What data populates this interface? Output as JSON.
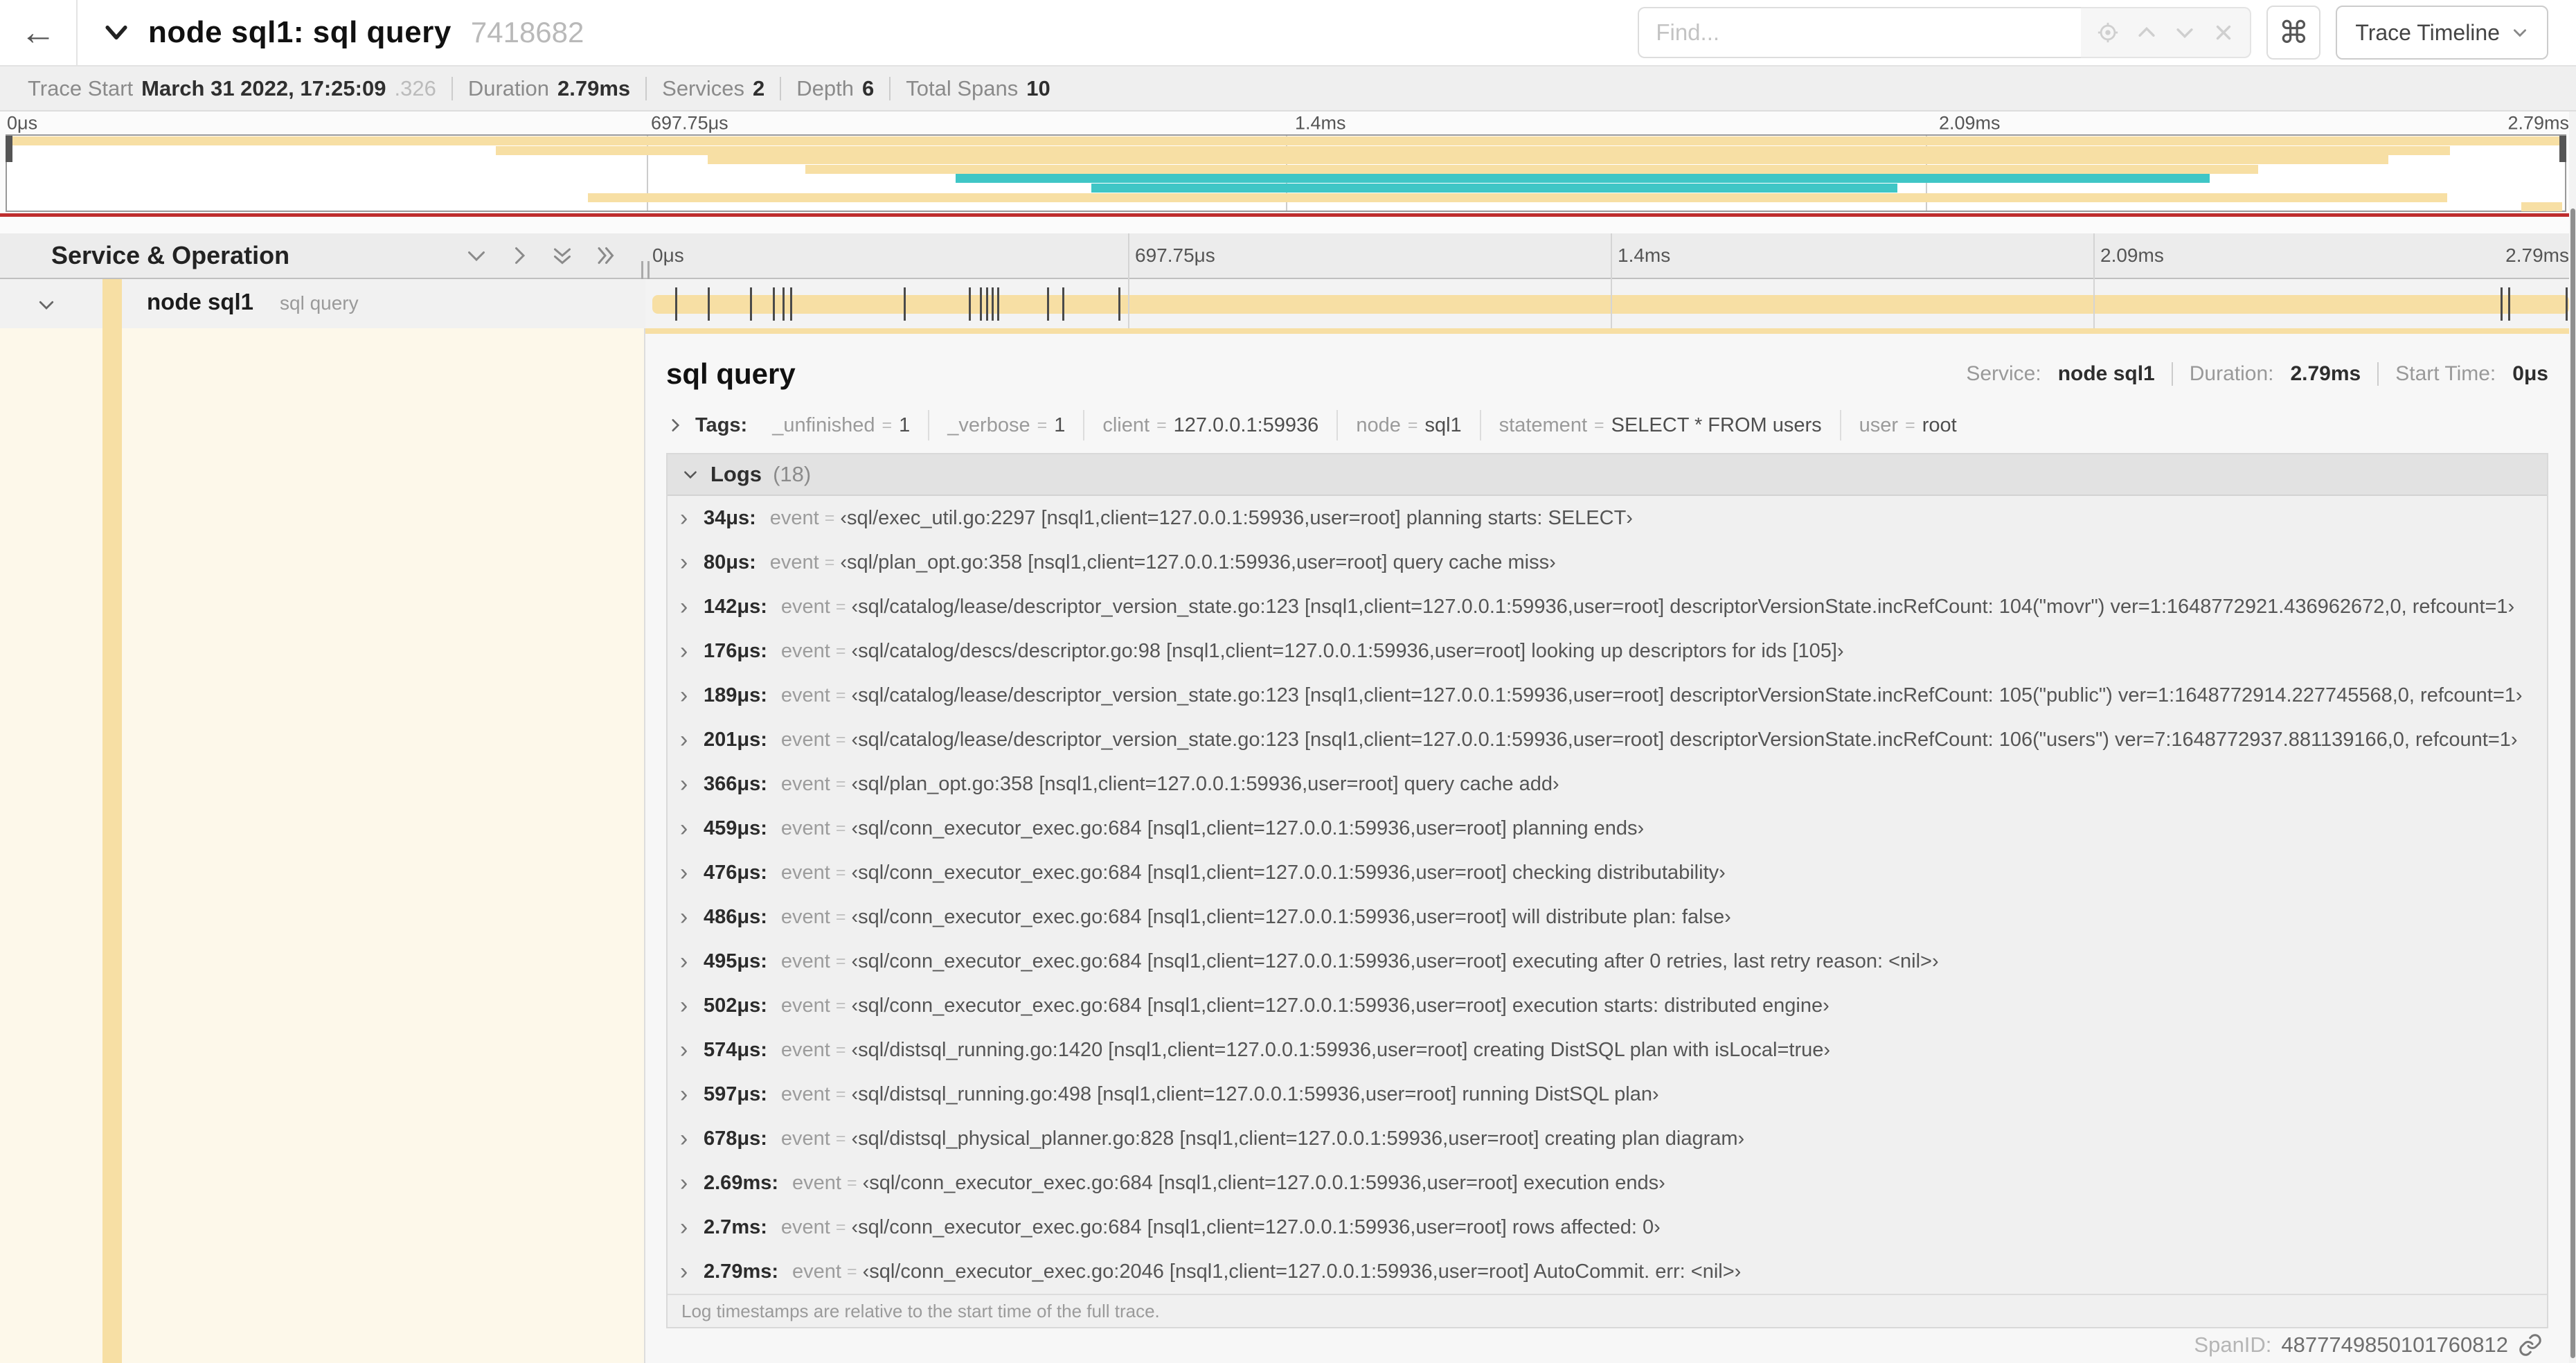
{
  "colors": {
    "tan": "#f7dfa4",
    "teal": "#3fc6c6",
    "red_line": "#be2d2d",
    "cream": "#fdf8ea"
  },
  "topbar": {
    "title": "node sql1: sql query",
    "trace_id": "7418682",
    "find_placeholder": "Find...",
    "command_icon": "⌘",
    "view_selector_label": "Trace Timeline"
  },
  "infobar": {
    "items": [
      {
        "label": "Trace Start",
        "value": "March 31 2022, 17:25:09",
        "suffix": ".326"
      },
      {
        "label": "Duration",
        "value": "2.79ms"
      },
      {
        "label": "Services",
        "value": "2"
      },
      {
        "label": "Depth",
        "value": "6"
      },
      {
        "label": "Total Spans",
        "value": "10"
      }
    ]
  },
  "timeline_ticks": [
    {
      "label": "0μs",
      "pct": 0
    },
    {
      "label": "697.75μs",
      "pct": 25
    },
    {
      "label": "1.4ms",
      "pct": 50
    },
    {
      "label": "2.09ms",
      "pct": 75
    },
    {
      "label": "2.79ms",
      "pct": 100
    }
  ],
  "minimap": {
    "spans": [
      {
        "row": 0,
        "start": 0,
        "end": 100,
        "color": "tan"
      },
      {
        "row": 1,
        "start": 19.1,
        "end": 95.5,
        "color": "tan"
      },
      {
        "row": 2,
        "start": 27.4,
        "end": 93.1,
        "color": "tan"
      },
      {
        "row": 3,
        "start": 31.2,
        "end": 88.0,
        "color": "tan"
      },
      {
        "row": 4,
        "start": 37.1,
        "end": 86.1,
        "color": "teal"
      },
      {
        "row": 5,
        "start": 42.4,
        "end": 73.9,
        "color": "teal"
      },
      {
        "row": 6,
        "start": 22.7,
        "end": 95.4,
        "color": "tan"
      },
      {
        "row": 7,
        "start": 98.3,
        "end": 99.9,
        "color": "tan"
      }
    ]
  },
  "table": {
    "header_label": "Service & Operation",
    "row": {
      "service": "node sql1",
      "operation": "sql query",
      "log_marks_pct": [
        1.2,
        2.9,
        5.1,
        6.3,
        6.8,
        7.2,
        13.1,
        16.5,
        17.1,
        17.4,
        17.7,
        18.0,
        20.6,
        21.4,
        24.3,
        96.4,
        96.8,
        99.8
      ]
    }
  },
  "detail": {
    "operation": "sql query",
    "service_label": "Service:",
    "service": "node sql1",
    "duration_label": "Duration:",
    "duration": "2.79ms",
    "start_label": "Start Time:",
    "start": "0μs",
    "tags": {
      "label": "Tags:",
      "items": [
        {
          "key": "_unfinished",
          "value": "1"
        },
        {
          "key": "_verbose",
          "value": "1"
        },
        {
          "key": "client",
          "value": "127.0.0.1:59936"
        },
        {
          "key": "node",
          "value": "sql1"
        },
        {
          "key": "statement",
          "value": "SELECT * FROM users"
        },
        {
          "key": "user",
          "value": "root"
        }
      ]
    },
    "logs": {
      "label": "Logs",
      "count": "(18)",
      "field_key": "event",
      "entries": [
        {
          "time": "34μs:",
          "value": "‹sql/exec_util.go:2297 [nsql1,client=127.0.0.1:59936,user=root] planning starts: SELECT›"
        },
        {
          "time": "80μs:",
          "value": "‹sql/plan_opt.go:358 [nsql1,client=127.0.0.1:59936,user=root] query cache miss›"
        },
        {
          "time": "142μs:",
          "value": "‹sql/catalog/lease/descriptor_version_state.go:123 [nsql1,client=127.0.0.1:59936,user=root] descriptorVersionState.incRefCount: 104(\"movr\") ver=1:1648772921.436962672,0, refcount=1›"
        },
        {
          "time": "176μs:",
          "value": "‹sql/catalog/descs/descriptor.go:98 [nsql1,client=127.0.0.1:59936,user=root] looking up descriptors for ids [105]›"
        },
        {
          "time": "189μs:",
          "value": "‹sql/catalog/lease/descriptor_version_state.go:123 [nsql1,client=127.0.0.1:59936,user=root] descriptorVersionState.incRefCount: 105(\"public\") ver=1:1648772914.227745568,0, refcount=1›"
        },
        {
          "time": "201μs:",
          "value": "‹sql/catalog/lease/descriptor_version_state.go:123 [nsql1,client=127.0.0.1:59936,user=root] descriptorVersionState.incRefCount: 106(\"users\") ver=7:1648772937.881139166,0, refcount=1›"
        },
        {
          "time": "366μs:",
          "value": "‹sql/plan_opt.go:358 [nsql1,client=127.0.0.1:59936,user=root] query cache add›"
        },
        {
          "time": "459μs:",
          "value": "‹sql/conn_executor_exec.go:684 [nsql1,client=127.0.0.1:59936,user=root] planning ends›"
        },
        {
          "time": "476μs:",
          "value": "‹sql/conn_executor_exec.go:684 [nsql1,client=127.0.0.1:59936,user=root] checking distributability›"
        },
        {
          "time": "486μs:",
          "value": "‹sql/conn_executor_exec.go:684 [nsql1,client=127.0.0.1:59936,user=root] will distribute plan: false›"
        },
        {
          "time": "495μs:",
          "value": "‹sql/conn_executor_exec.go:684 [nsql1,client=127.0.0.1:59936,user=root] executing after 0 retries, last retry reason: <nil>›"
        },
        {
          "time": "502μs:",
          "value": "‹sql/conn_executor_exec.go:684 [nsql1,client=127.0.0.1:59936,user=root] execution starts: distributed engine›"
        },
        {
          "time": "574μs:",
          "value": "‹sql/distsql_running.go:1420 [nsql1,client=127.0.0.1:59936,user=root] creating DistSQL plan with isLocal=true›"
        },
        {
          "time": "597μs:",
          "value": "‹sql/distsql_running.go:498 [nsql1,client=127.0.0.1:59936,user=root] running DistSQL plan›"
        },
        {
          "time": "678μs:",
          "value": "‹sql/distsql_physical_planner.go:828 [nsql1,client=127.0.0.1:59936,user=root] creating plan diagram›"
        },
        {
          "time": "2.69ms:",
          "value": "‹sql/conn_executor_exec.go:684 [nsql1,client=127.0.0.1:59936,user=root] execution ends›"
        },
        {
          "time": "2.7ms:",
          "value": "‹sql/conn_executor_exec.go:684 [nsql1,client=127.0.0.1:59936,user=root] rows affected: 0›"
        },
        {
          "time": "2.79ms:",
          "value": "‹sql/conn_executor_exec.go:2046 [nsql1,client=127.0.0.1:59936,user=root] AutoCommit. err: <nil>›"
        }
      ],
      "footnote": "Log timestamps are relative to the start time of the full trace."
    },
    "span_id_label": "SpanID:",
    "span_id": "4877749850101760812"
  }
}
